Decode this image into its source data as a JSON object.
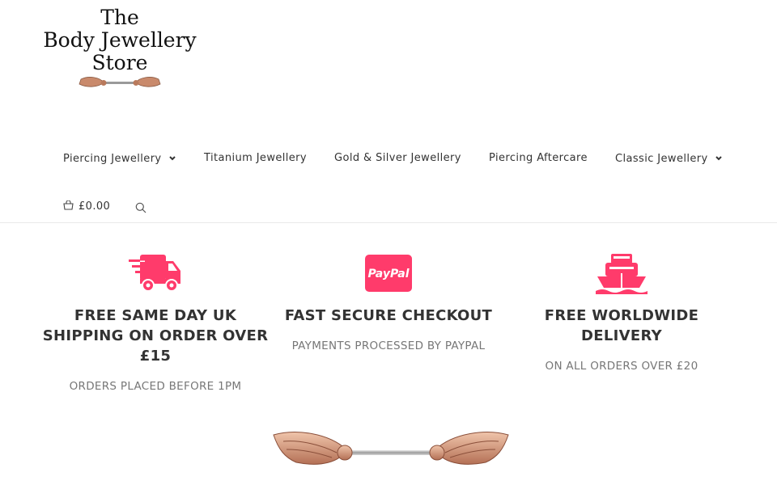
{
  "logo": {
    "line1": "The",
    "line2": "Body Jewellery",
    "line3": "Store",
    "icon": "winged-barbell-logo"
  },
  "nav": {
    "items": [
      {
        "label": "Piercing Jewellery",
        "has_dropdown": true
      },
      {
        "label": "Titanium Jewellery",
        "has_dropdown": false
      },
      {
        "label": "Gold & Silver Jewellery",
        "has_dropdown": false
      },
      {
        "label": "Piercing Aftercare",
        "has_dropdown": false
      },
      {
        "label": "Classic Jewellery",
        "has_dropdown": true
      }
    ],
    "cart_total": "£0.00",
    "cart_icon": "shopping-bag-icon",
    "search_icon": "search-icon"
  },
  "features": [
    {
      "icon": "delivery-truck-icon",
      "title": "FREE SAME DAY UK SHIPPING ON ORDER OVER £15",
      "subtitle": "ORDERS PLACED BEFORE 1PM"
    },
    {
      "icon": "paypal-icon",
      "icon_text": "PayPal",
      "title": "FAST SECURE CHECKOUT",
      "subtitle": "PAYMENTS PROCESSED BY PAYPAL"
    },
    {
      "icon": "ship-icon",
      "title": "FREE WORLDWIDE DELIVERY",
      "subtitle": "ON ALL ORDERS OVER £20"
    }
  ],
  "colors": {
    "accent": "#ff3b6b",
    "text": "#333333",
    "muted": "#777777",
    "rose_gold": "#c98a6c"
  }
}
